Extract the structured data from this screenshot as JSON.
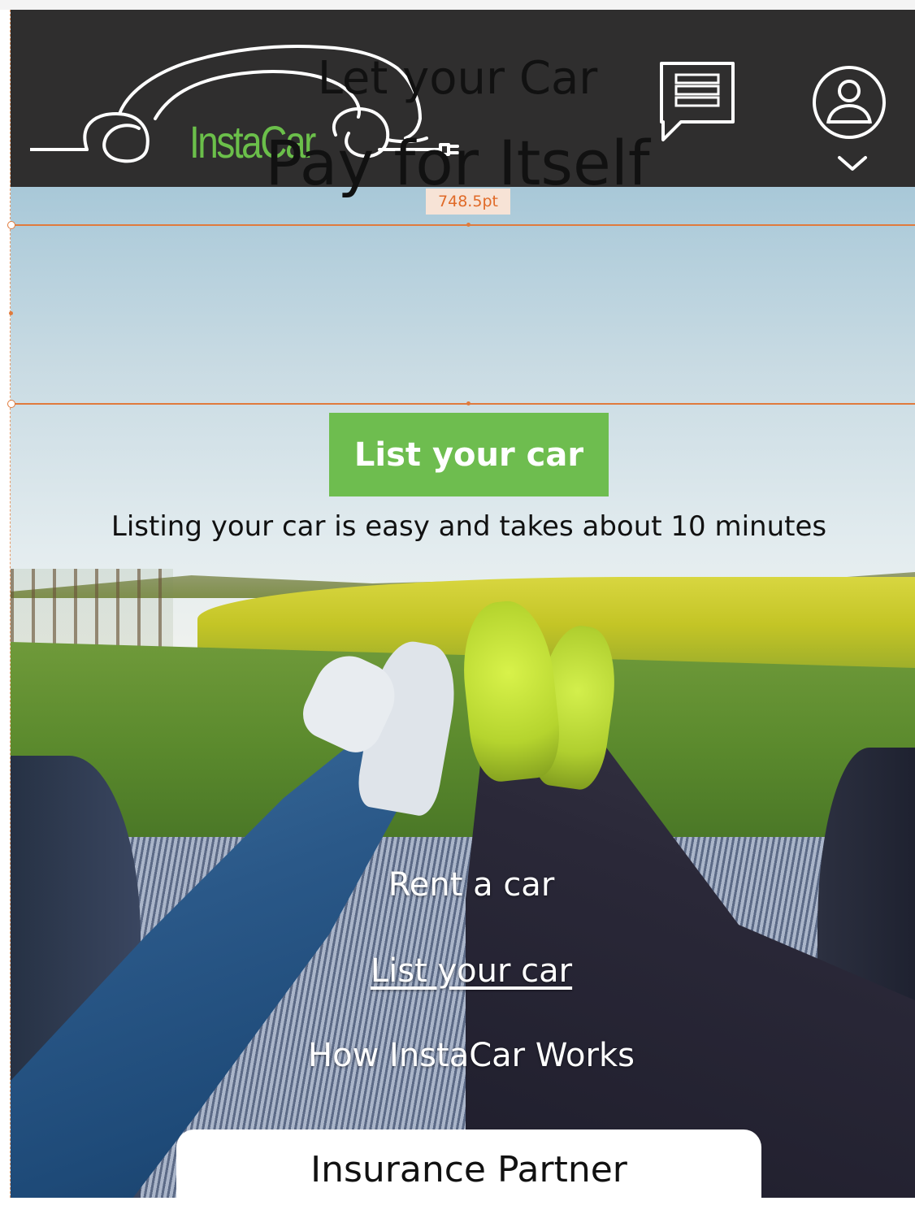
{
  "header": {
    "brand": "InstaCar",
    "colors": {
      "background": "#2f2e2e",
      "brand_green": "#6bbf4a"
    },
    "icons": [
      "chat-icon",
      "user-icon",
      "chevron-down-icon"
    ]
  },
  "overlay": {
    "dimension_label": "748.5pt"
  },
  "hero": {
    "headline_line1": "Let your Car",
    "headline_line2": "Pay for Itself",
    "cta_label": "List your car",
    "tagline": "Listing your car is easy and takes about 10 minutes",
    "colors": {
      "cta": "#6ebd4f"
    }
  },
  "nav": {
    "links": [
      "Rent a car",
      "List your car",
      "How InstaCar Works"
    ],
    "active_index": 1
  },
  "insurance": {
    "label": "Insurance Partner"
  }
}
